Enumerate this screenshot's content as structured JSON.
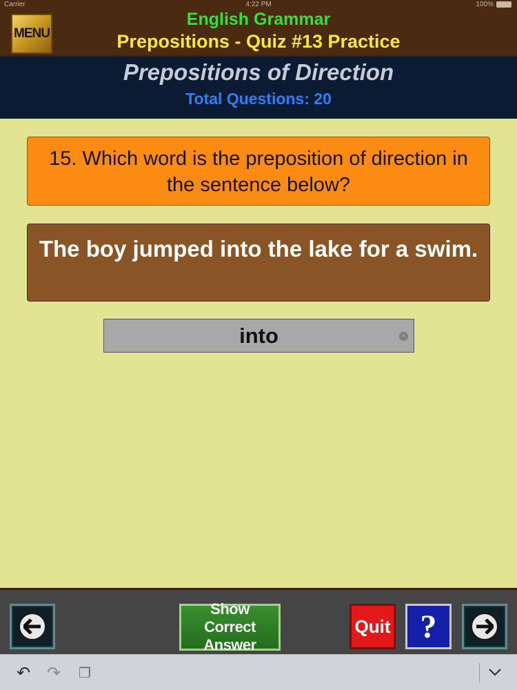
{
  "status_bar": {
    "carrier": "Carrier",
    "time": "4:22 PM",
    "battery": "100%"
  },
  "header": {
    "menu_label": "MENU",
    "app_title": "English Grammar",
    "quiz_title": "Prepositions - Quiz #13 Practice"
  },
  "topic": {
    "title": "Prepositions of Direction",
    "total_questions": "Total Questions: 20"
  },
  "question": {
    "text": "15. Which word is the preposition of direction in the sentence below?",
    "sentence": "The boy jumped into the lake for a swim."
  },
  "answer": {
    "value": "into"
  },
  "toolbar": {
    "show_answer_line1": "Show",
    "show_answer_line2": "Correct Answer",
    "quit_label": "Quit",
    "help_label": "?"
  },
  "colors": {
    "header_bg": "#4b2a12",
    "topic_bg": "#0b1b33",
    "page_bg": "#e2e493",
    "question_bg": "#fb8b12",
    "sentence_bg": "#8a5526",
    "quit_bg": "#e31818",
    "help_bg": "#1520a8",
    "show_bg": "#2d7d24"
  },
  "icons": {
    "prev": "arrow-left-icon",
    "next": "arrow-right-icon",
    "clear": "clear-circle-icon",
    "undo": "undo-icon",
    "redo": "redo-icon",
    "paste": "paste-icon",
    "dismiss": "chevron-down-icon"
  }
}
